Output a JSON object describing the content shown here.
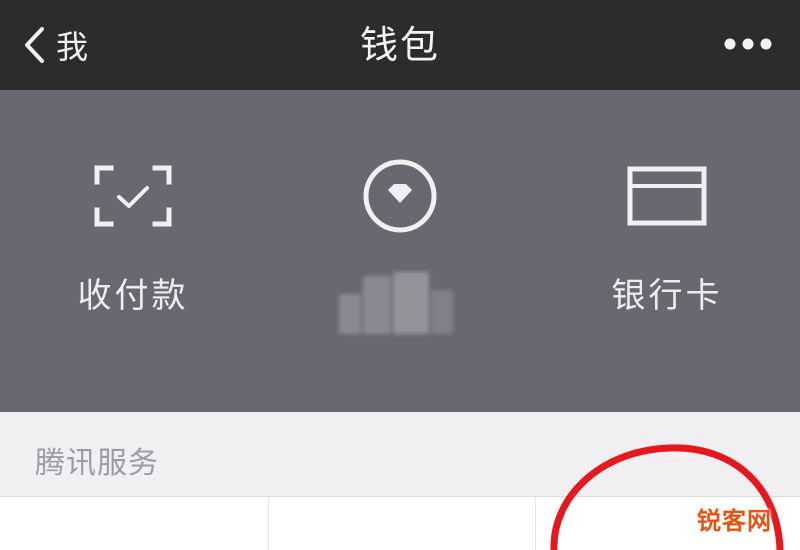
{
  "nav": {
    "back_label": "我",
    "title": "钱包"
  },
  "actions": [
    {
      "label": "收付款",
      "icon": "scan-pay-icon"
    },
    {
      "label": "",
      "icon": "balance-diamond-icon",
      "label_obscured": true
    },
    {
      "label": "银行卡",
      "icon": "bank-card-icon"
    }
  ],
  "services": {
    "header": "腾讯服务"
  },
  "watermark": "锐客网",
  "colors": {
    "top_bar_bg": "#2c2c2e",
    "panel_bg": "#676870",
    "section_bg": "#f0f0f2",
    "annotation_red": "#e3191e",
    "watermark_orange": "#e25514"
  }
}
